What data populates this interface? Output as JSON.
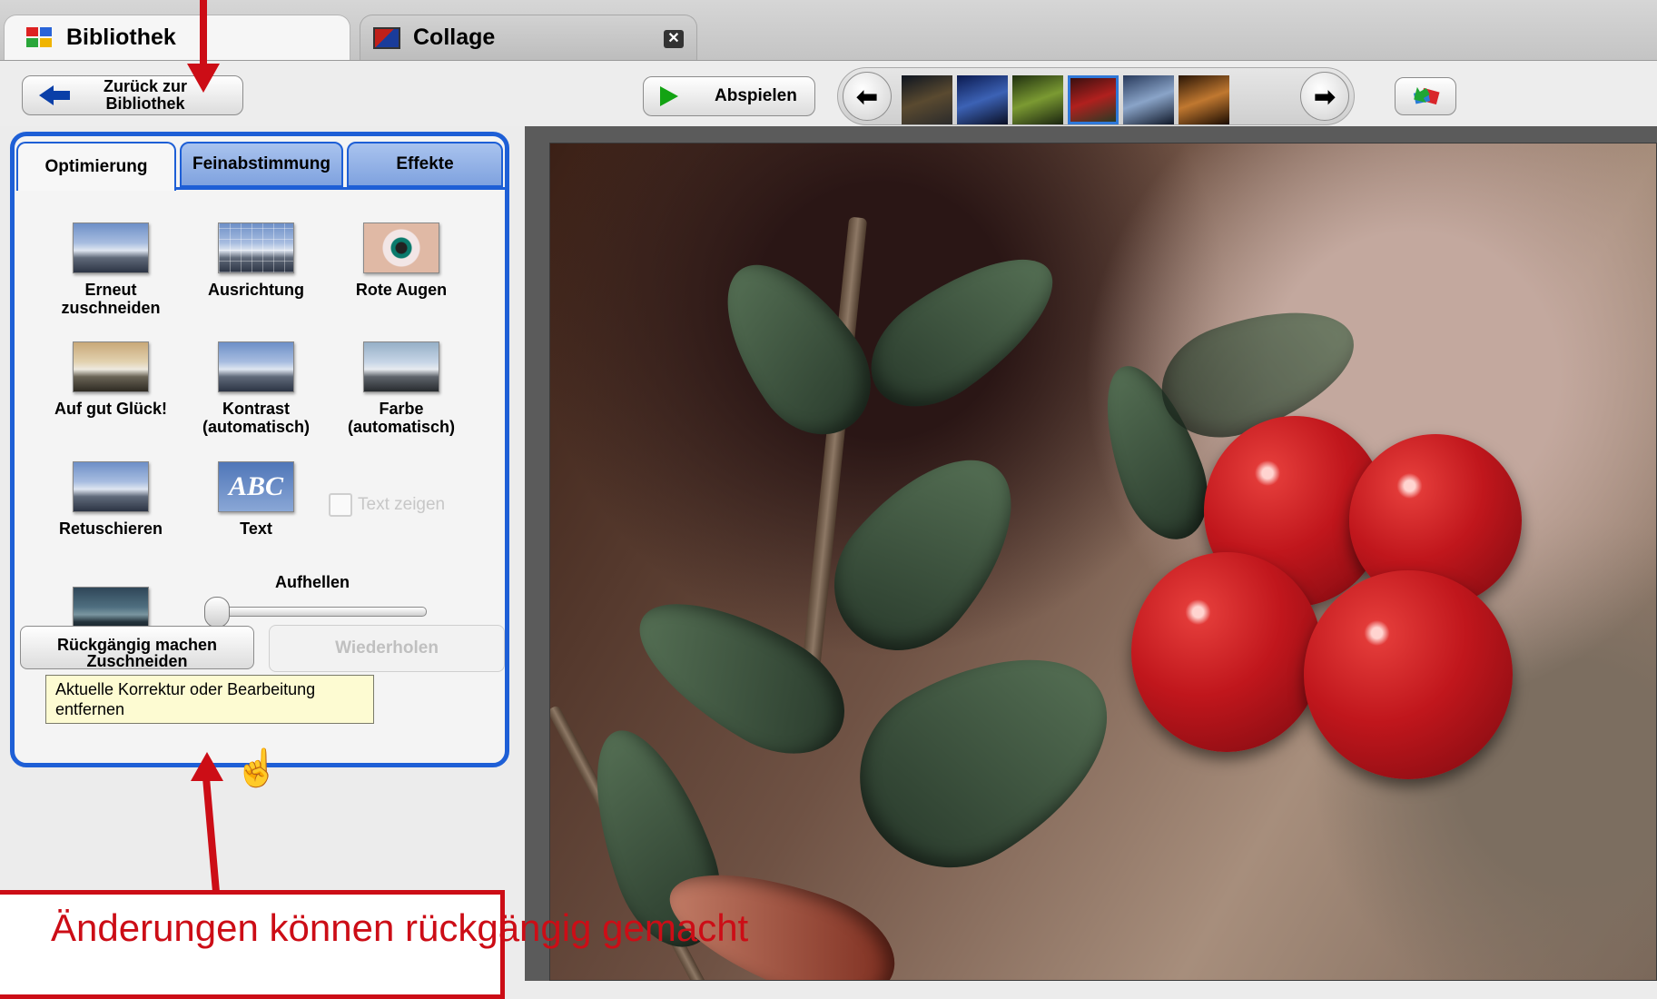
{
  "tabs": [
    {
      "label": "Bibliothek",
      "icon": "library-icon"
    },
    {
      "label": "Collage",
      "icon": "collage-icon",
      "close": "✕"
    }
  ],
  "toolbar": {
    "back_label": "Zurück zur Bibliothek",
    "play_label": "Abspielen",
    "prev_symbol": "⬅",
    "next_symbol": "➡"
  },
  "thumbnails": [
    {
      "name": "night-town",
      "colors": [
        "#0e1520",
        "#5a4a30",
        "#2b2b2b"
      ]
    },
    {
      "name": "blue-mountains",
      "colors": [
        "#0b1a50",
        "#3c62b5",
        "#0a0f24"
      ]
    },
    {
      "name": "green-plants",
      "colors": [
        "#203010",
        "#7b9a32",
        "#1a2410"
      ]
    },
    {
      "name": "red-berries",
      "colors": [
        "#3a1010",
        "#b0201e",
        "#2a3a24"
      ],
      "selected": true
    },
    {
      "name": "snowy-trees",
      "colors": [
        "#283a5c",
        "#8aa4c8",
        "#101828"
      ]
    },
    {
      "name": "autumn-window",
      "colors": [
        "#2a1606",
        "#c07830",
        "#1a0c02"
      ]
    }
  ],
  "panel": {
    "tabs": [
      "Optimierung",
      "Feinabstimmung",
      "Effekte"
    ],
    "tools": [
      {
        "label": "Erneut zuschneiden",
        "icon": "crop-icon"
      },
      {
        "label": "Ausrichtung",
        "icon": "straighten-icon"
      },
      {
        "label": "Rote Augen",
        "icon": "red-eye-icon"
      },
      {
        "label": "Auf gut Glück!",
        "icon": "auto-fix-icon"
      },
      {
        "label": "Kontrast (automatisch)",
        "icon": "auto-contrast-icon"
      },
      {
        "label": "Farbe (automatisch)",
        "icon": "auto-color-icon"
      },
      {
        "label": "Retuschieren",
        "icon": "retouch-icon"
      },
      {
        "label": "Text",
        "icon": "text-icon",
        "icon_text": "ABC"
      }
    ],
    "show_text_label": "Text zeigen",
    "show_text_checked": false,
    "brighten_label": "Aufhellen",
    "brighten_value": 0,
    "undo_label": "Rückgängig machen Zuschneiden",
    "redo_label": "Wiederholen",
    "tooltip": "Aktuelle Korrektur oder Bearbeitung entfernen"
  },
  "annotation": {
    "text": "Änderungen können rückgängig gemacht",
    "color": "#cc0d16"
  },
  "colors": {
    "panel_border": "#1e5fd6",
    "selected_thumb": "#2f78d8",
    "play_green": "#13a313"
  }
}
